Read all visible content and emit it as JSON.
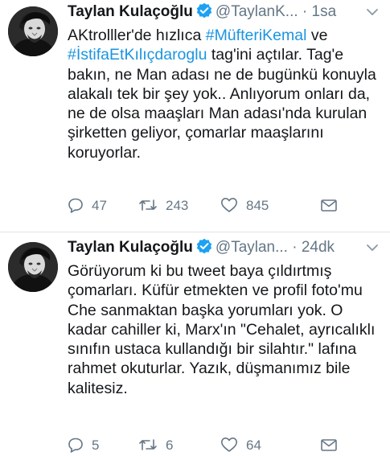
{
  "tweets": [
    {
      "display_name": "Taylan Kulaçoğlu",
      "handle": "@TaylanK...",
      "separator": "·",
      "time": "1sa",
      "text_segments": [
        {
          "text": "AKtrolller'de hızlıca ",
          "kind": "text"
        },
        {
          "text": "#MüfteriKemal",
          "kind": "hashtag"
        },
        {
          "text": " ve ",
          "kind": "text"
        },
        {
          "text": "#İstifaEtKılıçdaroglu",
          "kind": "hashtag"
        },
        {
          "text": " tag'ini açtılar. Tag'e bakın, ne Man adası ne de bugünkü konuyla alakalı tek bir şey yok.. Anlıyorum onları da, ne de olsa maaşları Man adası'nda kurulan şirketten geliyor, çomarlar maaşlarını koruyorlar.",
          "kind": "text"
        }
      ],
      "stats": {
        "replies": "47",
        "retweets": "243",
        "likes": "845"
      }
    },
    {
      "display_name": "Taylan Kulaçoğlu",
      "handle": "@Taylan...",
      "separator": "·",
      "time": "24dk",
      "text_segments": [
        {
          "text": "Görüyorum ki bu tweet baya çıldırtmış çomarları. Küfür etmekten ve profil foto'mu Che sanmaktan başka yorumları yok. O kadar cahiller ki, Marx'ın \"Cehalet, ayrıcalıklı sınıfın ustaca kullandığı bir silahtır.\" lafına rahmet okuturlar. Yazık, düşmanımız bile kalitesiz.",
          "kind": "text"
        }
      ],
      "stats": {
        "replies": "5",
        "retweets": "6",
        "likes": "64"
      }
    }
  ],
  "icons": {
    "reply": "reply-icon",
    "retweet": "retweet-icon",
    "like": "heart-icon",
    "dm": "envelope-icon",
    "verified": "verified-badge-icon",
    "more": "chevron-down-icon"
  },
  "colors": {
    "text": "#14171a",
    "secondary": "#657786",
    "hashtag": "#1b95e0",
    "verified": "#1da1f2",
    "divider": "#dfe3e6"
  }
}
